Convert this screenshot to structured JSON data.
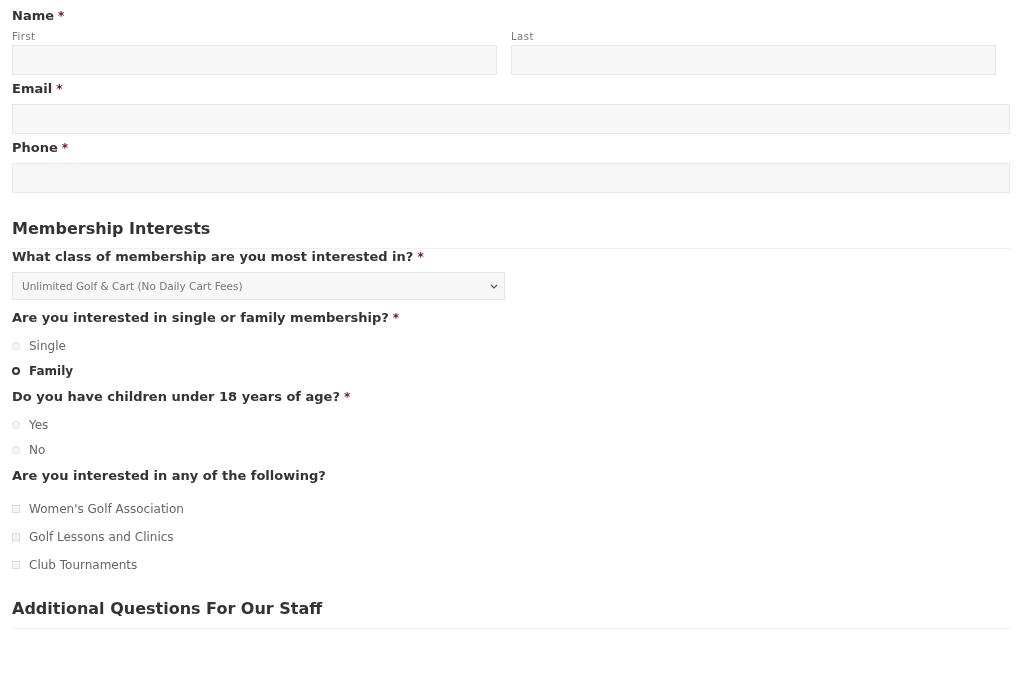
{
  "fields": [
    {
      "kind": "name",
      "label": "Name",
      "mark": "*",
      "parts": [
        {
          "sublabel": "First"
        },
        {
          "sublabel": "Last"
        }
      ]
    },
    {
      "kind": "text",
      "label": "Email",
      "mark": "*"
    },
    {
      "kind": "text",
      "label": "Phone",
      "mark": "*"
    },
    {
      "kind": "heading",
      "label": "Membership Interests"
    },
    {
      "kind": "select",
      "label": "What class of membership are you most interested in?",
      "mark": "*",
      "value": "Unlimited Golf & Cart (No Daily Cart Fees)"
    },
    {
      "kind": "radio",
      "label": "Are you interested in single or family membership?",
      "mark": "*",
      "options": [
        {
          "label": "Single",
          "selected": false
        },
        {
          "label": "Family",
          "selected": true
        }
      ]
    },
    {
      "kind": "radio",
      "label": "Do you have children under 18 years of age?",
      "mark": "*",
      "options": [
        {
          "label": "Yes",
          "selected": false
        },
        {
          "label": "No",
          "selected": false
        }
      ]
    },
    {
      "kind": "checkbox",
      "label": "Are you interested in any of the following?",
      "options": [
        {
          "label": "Women's Golf Association",
          "checked": false
        },
        {
          "label": "Golf Lessons and Clinics",
          "checked": false
        },
        {
          "label": "Club Tournaments",
          "checked": false
        }
      ]
    },
    {
      "kind": "heading",
      "label": "Additional Questions For Our Staff"
    }
  ]
}
